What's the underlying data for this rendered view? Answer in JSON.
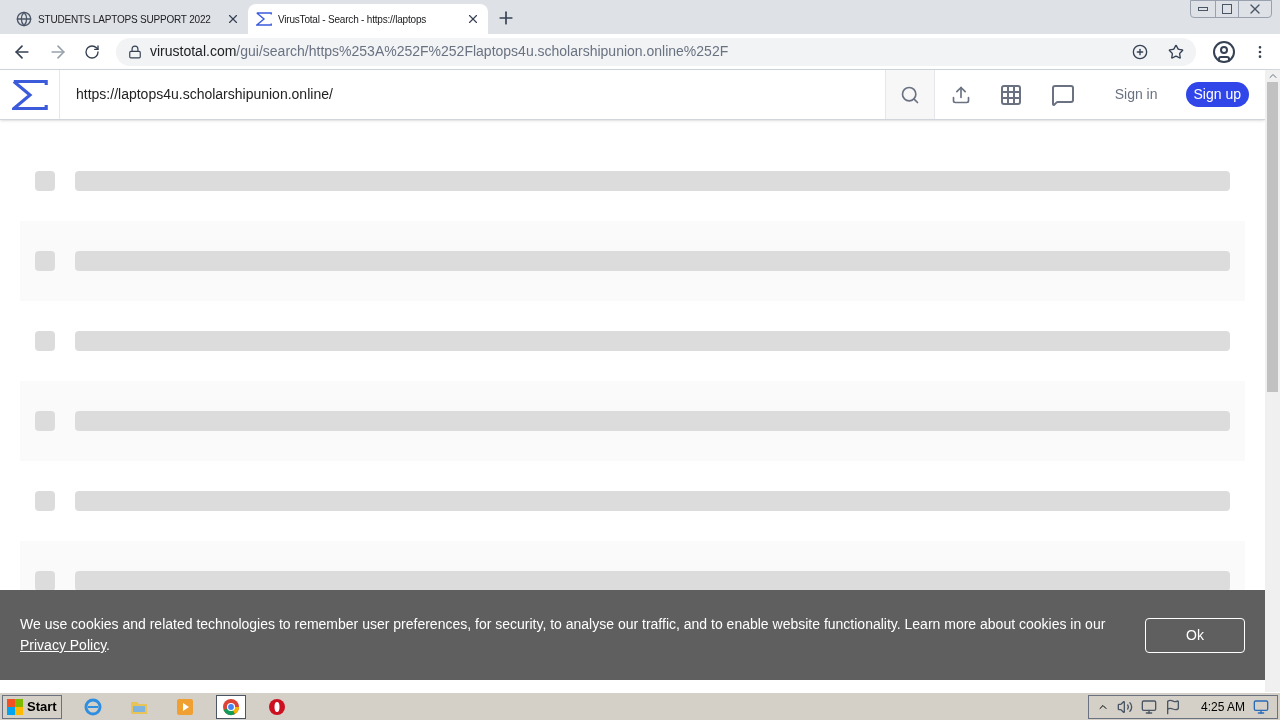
{
  "browser": {
    "tabs": [
      {
        "title": "STUDENTS LAPTOPS SUPPORT 2022",
        "selected": false
      },
      {
        "title": "VirusTotal - Search - https://laptops",
        "selected": true
      }
    ],
    "address": {
      "domain": "virustotal.com",
      "path": "/gui/search/https%253A%252F%252Flaptops4u.scholarshipunion.online%252F"
    }
  },
  "header": {
    "search_value": "https://laptops4u.scholarshipunion.online/",
    "sign_in": "Sign in",
    "sign_up": "Sign up"
  },
  "cookie_banner": {
    "text": "We use cookies and related technologies to remember user preferences, for security, to analyse our traffic, and to enable website functionality. Learn more about cookies in our",
    "link": "Privacy Policy",
    "suffix": ".",
    "button": "Ok"
  },
  "taskbar": {
    "start": "Start",
    "apps": [
      {
        "selected": false
      },
      {
        "selected": false
      },
      {
        "selected": false
      },
      {
        "selected": true
      },
      {
        "selected": false
      }
    ],
    "clock": "4:25 AM"
  }
}
